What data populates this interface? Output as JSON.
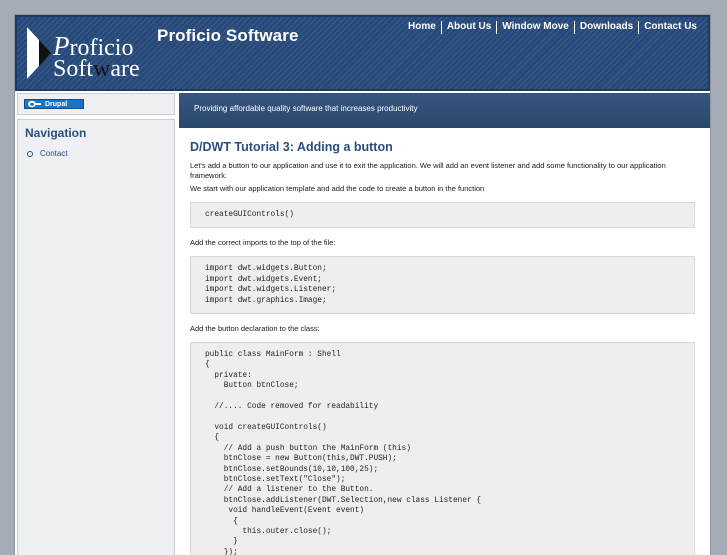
{
  "header": {
    "logo_line1": "Proficio",
    "logo_line2": "Software",
    "site_name": "Proficio Software",
    "nav": [
      "Home",
      "About Us",
      "Window Move",
      "Downloads",
      "Contact Us"
    ]
  },
  "sidebar": {
    "badge_label": "Drupal",
    "nav_title": "Navigation",
    "nav_items": [
      "Contact"
    ]
  },
  "slogan": "Providing affordable quality software that increases productivity",
  "article": {
    "title": "D/DWT Tutorial 3: Adding a button",
    "intro": "Let's add a button to our application and use it to exit the application. We will add an event listener and add some functionality to our application framework.",
    "p2": "We start with our application template and add the code to create a button in the function",
    "code1": "createGUIControls()",
    "p3": "Add the correct imports to the top of the file:",
    "code2": "import dwt.widgets.Button;\nimport dwt.widgets.Event;\nimport dwt.widgets.Listener;\nimport dwt.graphics.Image;",
    "p4": "Add the button declaration to the class:",
    "code3": "public class MainForm : Shell\n{\n  private:\n    Button btnClose;\n\n  //.... Code removed for readability\n\n  void createGUIControls()\n  {\n    // Add a push button the MainForm (this)\n    btnClose = new Button(this,DWT.PUSH);\n    btnClose.setBounds(10,10,100,25);\n    btnClose.setText(\"Close\");\n    // Add a listener to the Button.\n    btnClose.addListener(DWT.Selection,new class Listener {\n     void handleEvent(Event event)\n      {\n        this.outer.close();\n      }\n    });"
  }
}
